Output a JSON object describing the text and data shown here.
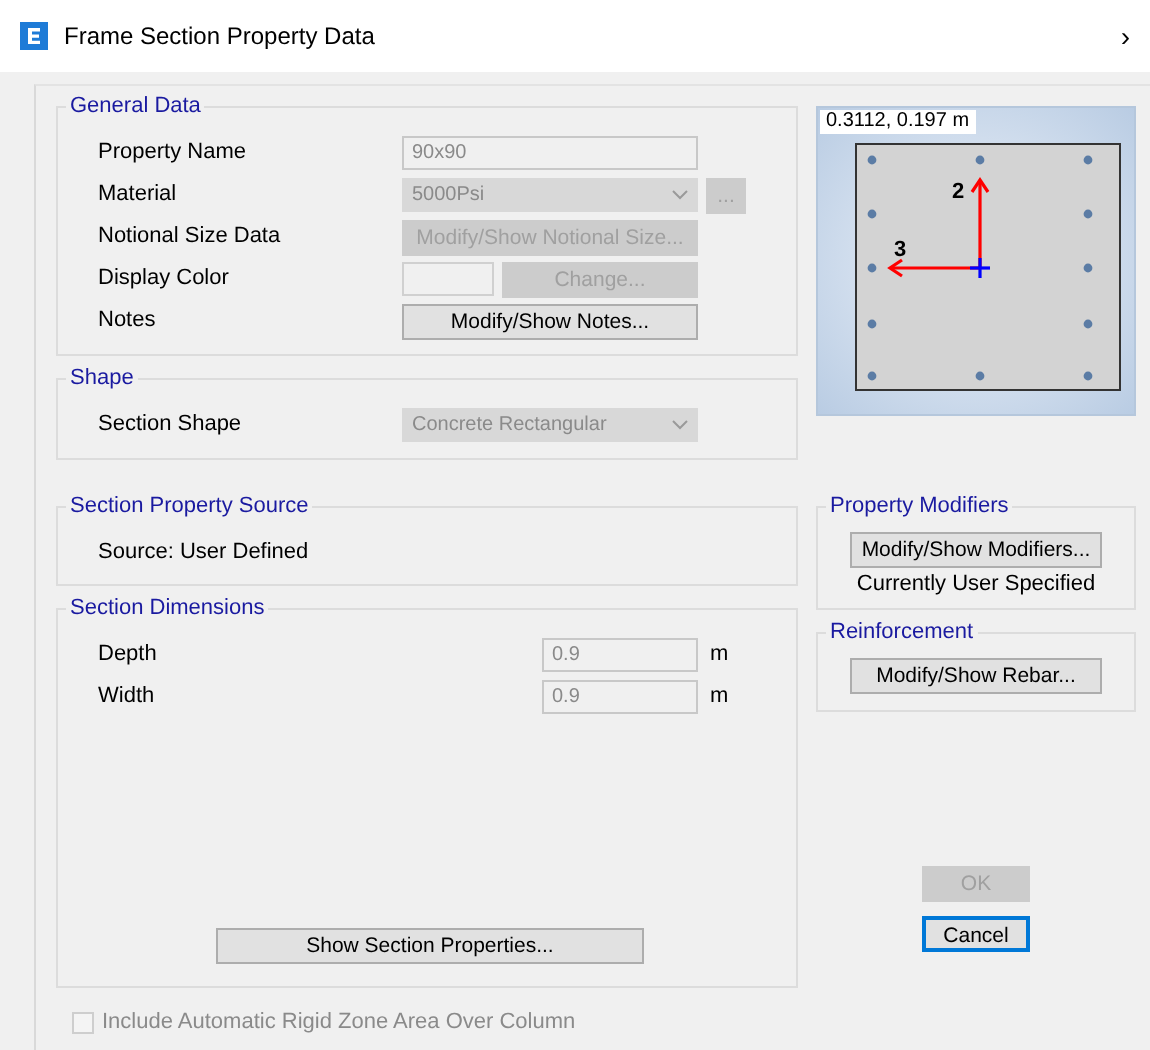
{
  "window": {
    "title": "Frame Section Property Data",
    "close_glyph": "›"
  },
  "general_data": {
    "legend": "General Data",
    "rows": [
      {
        "label": "Property Name",
        "kind": "input",
        "value": "90x90",
        "disabled": true
      },
      {
        "label": "Material",
        "kind": "select",
        "value": "5000Psi",
        "disabled": true,
        "extra_button": "..."
      },
      {
        "label": "Notional Size Data",
        "kind": "button",
        "button": "Modify/Show Notional Size...",
        "disabled": true
      },
      {
        "label": "Display Color",
        "kind": "color",
        "button": "Change...",
        "disabled": true
      },
      {
        "label": "Notes",
        "kind": "button",
        "button": "Modify/Show Notes...",
        "disabled": false
      }
    ]
  },
  "shape": {
    "legend": "Shape",
    "label": "Section Shape",
    "value": "Concrete Rectangular",
    "disabled": true
  },
  "property_source": {
    "legend": "Section Property Source",
    "text": "Source:  User Defined"
  },
  "dimensions": {
    "legend": "Section Dimensions",
    "rows": [
      {
        "label": "Depth",
        "value": "0.9",
        "unit": "m",
        "disabled": true
      },
      {
        "label": "Width",
        "value": "0.9",
        "unit": "m",
        "disabled": true
      }
    ],
    "button": "Show Section Properties..."
  },
  "rigid_zone": {
    "label": "Include Automatic Rigid Zone Area Over Column",
    "checked": false,
    "disabled": true
  },
  "preview": {
    "readout": "0.3112, 0.197 m",
    "axis_2": "2",
    "axis_3": "3"
  },
  "property_modifiers": {
    "legend": "Property Modifiers",
    "button": "Modify/Show Modifiers...",
    "status": "Currently User Specified"
  },
  "reinforcement": {
    "legend": "Reinforcement",
    "button": "Modify/Show Rebar..."
  },
  "buttons": [
    {
      "label": "OK",
      "disabled": true,
      "default": false
    },
    {
      "label": "Cancel",
      "disabled": false,
      "default": true
    }
  ]
}
